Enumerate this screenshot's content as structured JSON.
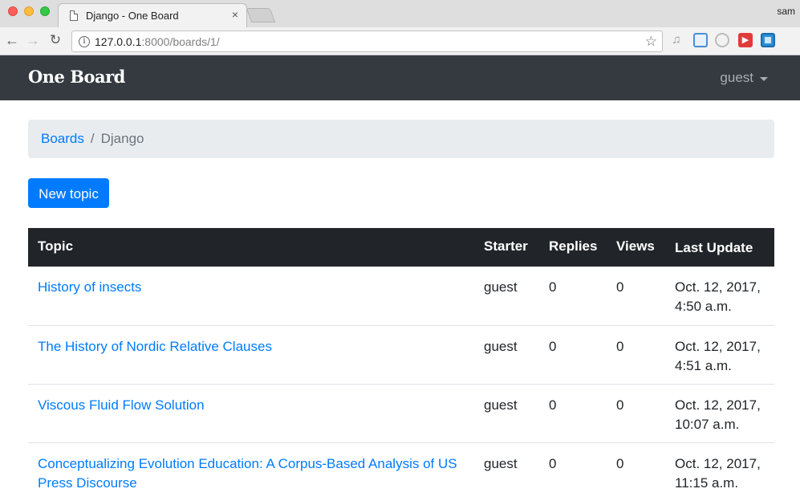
{
  "browser": {
    "tab_title": "Django - One Board",
    "tab_close": "×",
    "profile_name": "sam",
    "url_host": "127.0.0.1",
    "url_rest": ":8000/boards/1/"
  },
  "navbar": {
    "brand": "One Board",
    "user": "guest"
  },
  "breadcrumb": {
    "items": [
      "Boards",
      "Django"
    ],
    "separator": "/"
  },
  "actions": {
    "new_topic": "New topic"
  },
  "table": {
    "headers": [
      "Topic",
      "Starter",
      "Replies",
      "Views",
      "Last Update"
    ],
    "rows": [
      {
        "topic": "History of insects",
        "starter": "guest",
        "replies": "0",
        "views": "0",
        "last_update_date": "Oct. 12, 2017,",
        "last_update_time": "4:50 a.m."
      },
      {
        "topic": "The History of Nordic Relative Clauses",
        "starter": "guest",
        "replies": "0",
        "views": "0",
        "last_update_date": "Oct. 12, 2017,",
        "last_update_time": "4:51 a.m."
      },
      {
        "topic": "Viscous Fluid Flow Solution",
        "starter": "guest",
        "replies": "0",
        "views": "0",
        "last_update_date": "Oct. 12, 2017,",
        "last_update_time": "10:07 a.m."
      },
      {
        "topic": "Conceptualizing Evolution Education: A Corpus-Based Analysis of US Press Discourse",
        "starter": "guest",
        "replies": "0",
        "views": "0",
        "last_update_date": "Oct. 12, 2017,",
        "last_update_time": "11:15 a.m."
      }
    ]
  },
  "colors": {
    "navbar_bg": "#343a40",
    "primary": "#007bff",
    "table_head_bg": "#212529",
    "breadcrumb_bg": "#e9ecef"
  }
}
